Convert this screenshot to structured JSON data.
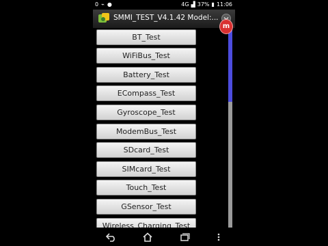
{
  "status": {
    "battery_percent": "37%",
    "time": "11:06",
    "left_glyph": "0",
    "signal_label": "4G"
  },
  "app": {
    "title": "SMMI_TEST_V4.1.42 Model:..."
  },
  "tests": [
    {
      "label": "BT_Test"
    },
    {
      "label": "WiFiBus_Test"
    },
    {
      "label": "Battery_Test"
    },
    {
      "label": "ECompass_Test"
    },
    {
      "label": "Gyroscope_Test"
    },
    {
      "label": "ModemBus_Test"
    },
    {
      "label": "SDcard_Test"
    },
    {
      "label": "SIMcard_Test"
    },
    {
      "label": "Touch_Test"
    },
    {
      "label": "GSensor_Test"
    },
    {
      "label": "Wireless_Charging_Test"
    }
  ],
  "floating": {
    "label": "m"
  },
  "scrollbar": {
    "thumb_fraction": 0.37
  },
  "colors": {
    "scroll_thumb": "#4c4cde",
    "float_badge": "#d93030"
  },
  "icons": {
    "back": "back-icon",
    "home": "home-icon",
    "recents": "recents-icon",
    "menu": "overflow-menu-icon"
  }
}
